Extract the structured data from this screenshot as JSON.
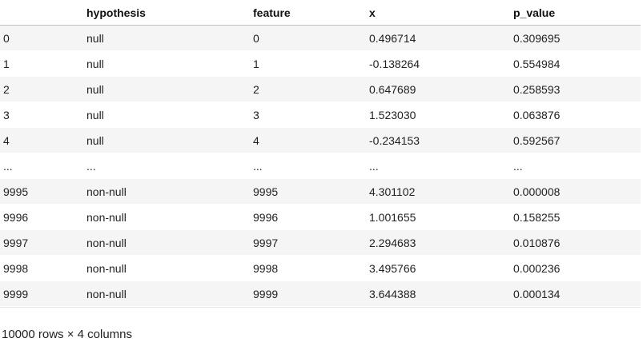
{
  "table": {
    "columns": [
      "",
      "hypothesis",
      "feature",
      "x",
      "p_value"
    ],
    "rows": [
      [
        "0",
        "null",
        "0",
        "0.496714",
        "0.309695"
      ],
      [
        "1",
        "null",
        "1",
        "-0.138264",
        "0.554984"
      ],
      [
        "2",
        "null",
        "2",
        "0.647689",
        "0.258593"
      ],
      [
        "3",
        "null",
        "3",
        "1.523030",
        "0.063876"
      ],
      [
        "4",
        "null",
        "4",
        "-0.234153",
        "0.592567"
      ],
      [
        "...",
        "...",
        "...",
        "...",
        "..."
      ],
      [
        "9995",
        "non-null",
        "9995",
        "4.301102",
        "0.000008"
      ],
      [
        "9996",
        "non-null",
        "9996",
        "1.001655",
        "0.158255"
      ],
      [
        "9997",
        "non-null",
        "9997",
        "2.294683",
        "0.010876"
      ],
      [
        "9998",
        "non-null",
        "9998",
        "3.495766",
        "0.000236"
      ],
      [
        "9999",
        "non-null",
        "9999",
        "3.644388",
        "0.000134"
      ]
    ]
  },
  "shape_caption": "10000 rows × 4 columns"
}
